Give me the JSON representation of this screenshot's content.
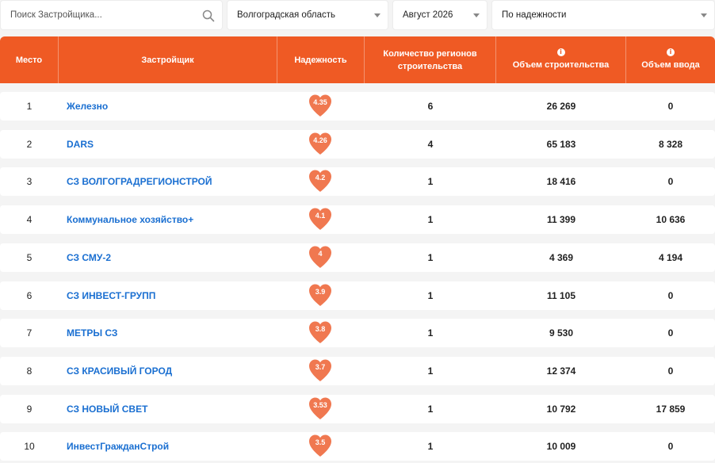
{
  "filters": {
    "search_placeholder": "Поиск Застройщика...",
    "region": "Волгоградская область",
    "month": "Август 2026",
    "sort": "По надежности"
  },
  "columns": {
    "place": "Место",
    "developer": "Застройщик",
    "reliability": "Надежность",
    "regions": "Количество регионов строительства",
    "volume": "Объем строительства",
    "commissioning": "Объем ввода"
  },
  "colors": {
    "accent": "#ef5a24",
    "heart": "#f07850",
    "link": "#1a6fd1"
  },
  "rows": [
    {
      "place": "1",
      "name": "Железно",
      "reliability": "4.35",
      "regions": "6",
      "volume": "26 269",
      "commissioning": "0"
    },
    {
      "place": "2",
      "name": "DARS",
      "reliability": "4.26",
      "regions": "4",
      "volume": "65 183",
      "commissioning": "8 328"
    },
    {
      "place": "3",
      "name": "СЗ ВОЛГОГРАДРЕГИОНСТРОЙ",
      "reliability": "4.2",
      "regions": "1",
      "volume": "18 416",
      "commissioning": "0"
    },
    {
      "place": "4",
      "name": "Коммунальное хозяйство+",
      "reliability": "4.1",
      "regions": "1",
      "volume": "11 399",
      "commissioning": "10 636"
    },
    {
      "place": "5",
      "name": "СЗ СМУ-2",
      "reliability": "4",
      "regions": "1",
      "volume": "4 369",
      "commissioning": "4 194"
    },
    {
      "place": "6",
      "name": "СЗ ИНВЕСТ-ГРУПП",
      "reliability": "3.9",
      "regions": "1",
      "volume": "11 105",
      "commissioning": "0"
    },
    {
      "place": "7",
      "name": "МЕТРЫ СЗ",
      "reliability": "3.8",
      "regions": "1",
      "volume": "9 530",
      "commissioning": "0"
    },
    {
      "place": "8",
      "name": "СЗ КРАСИВЫЙ ГОРОД",
      "reliability": "3.7",
      "regions": "1",
      "volume": "12 374",
      "commissioning": "0"
    },
    {
      "place": "9",
      "name": "СЗ НОВЫЙ СВЕТ",
      "reliability": "3.53",
      "regions": "1",
      "volume": "10 792",
      "commissioning": "17 859"
    },
    {
      "place": "10",
      "name": "ИнвестГражданСтрой",
      "reliability": "3.5",
      "regions": "1",
      "volume": "10 009",
      "commissioning": "0"
    }
  ]
}
